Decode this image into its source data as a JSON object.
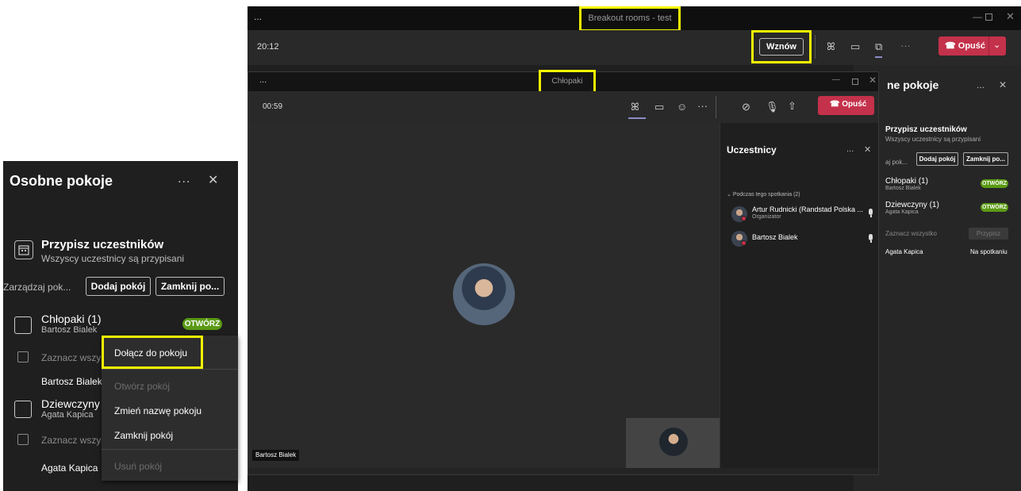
{
  "left_panel": {
    "title": "Osobne pokoje",
    "more_icon": "...",
    "close_icon": "✕",
    "assign_title": "Przypisz uczestników",
    "assign_subtitle": "Wszyscy uczestnicy są przypisani",
    "manage_label": "Zarządzaj pok...",
    "add_room": "Dodaj pokój",
    "close_rooms": "Zamknij po...",
    "rooms": [
      {
        "name": "Chłopaki (1)",
        "member": "Bartosz Bialek",
        "badge": "OTWÓRZ",
        "select_all": "Zaznacz wszyst",
        "participant": "Bartosz Bialek"
      },
      {
        "name": "Dziewczyny (",
        "member": "Agata Kapica",
        "select_all": "Zaznacz wszyst",
        "participant": "Agata Kapica"
      }
    ],
    "context_menu": {
      "join": "Dołącz do pokoju",
      "open": "Otwórz pokój",
      "rename": "Zmień nazwę pokoju",
      "close": "Zamknij pokój",
      "delete": "Usuń pokój"
    }
  },
  "main_window": {
    "more": "...",
    "title": "Breakout rooms - test",
    "time": "20:12",
    "resume": "Wznów",
    "leave": "Opuść",
    "panel": {
      "title": "ne pokoje",
      "more": "...",
      "close": "✕",
      "assign_title": "Przypisz uczestników",
      "assign_subtitle": "Wszyscy uczestnicy są przypisani",
      "manage": "aj pok...",
      "add_room": "Dodaj pokój",
      "close_rooms": "Zamknij po...",
      "rooms": [
        {
          "name": "Chłopaki (1)",
          "member": "Bartosz Bialek",
          "badge": "OTWÓRZ"
        },
        {
          "name": "Dziewczyny (1)",
          "member": "Agata Kapica",
          "badge": "OTWÓRZ"
        }
      ],
      "select_all": "Zaznacz wszystko",
      "assign_btn": "Przypisz",
      "participant": "Agata Kapica",
      "participant_status": "Na spotkaniu"
    }
  },
  "inner_window": {
    "more": "...",
    "title": "Chłopaki",
    "time": "00:59",
    "leave": "Opuść",
    "stage_name": "Bartosz Bialek",
    "participants_panel": {
      "title": "Uczestnicy",
      "more": "...",
      "close": "✕",
      "section": "Podczas tego spotkania (2)",
      "people": [
        {
          "name": "Artur Rudnicki (Randstad Polska ...",
          "role": "Organizator"
        },
        {
          "name": "Bartosz Bialek"
        }
      ]
    }
  },
  "colors": {
    "highlight": "#f5f500",
    "leave_red": "#c4314b",
    "open_badge": "#5b9a15",
    "panel_bg": "#1f1f1f"
  }
}
